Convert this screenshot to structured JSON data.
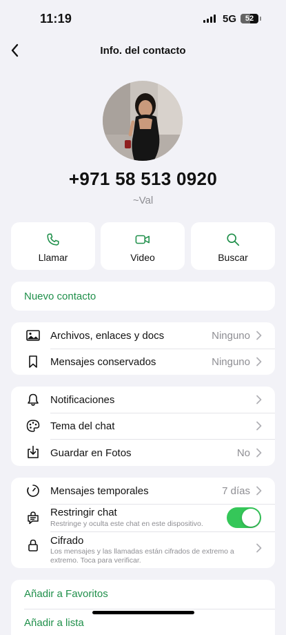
{
  "status_bar": {
    "time": "11:19",
    "network": "5G",
    "battery": "52",
    "battery_level": 0.52
  },
  "nav": {
    "title": "Info. del contacto",
    "back_icon": "chevron-left-icon"
  },
  "contact": {
    "phone": "+971 58 513 0920",
    "alias": "~Val"
  },
  "actions": [
    {
      "label": "Llamar",
      "icon": "phone-icon"
    },
    {
      "label": "Video",
      "icon": "video-icon"
    },
    {
      "label": "Buscar",
      "icon": "search-icon"
    }
  ],
  "new_contact": {
    "label": "Nuevo contacto"
  },
  "media_group": [
    {
      "label": "Archivos, enlaces y docs",
      "value": "Ninguno",
      "icon": "image-icon"
    },
    {
      "label": "Mensajes conservados",
      "value": "Ninguno",
      "icon": "bookmark-icon"
    }
  ],
  "settings_group": [
    {
      "label": "Notificaciones",
      "value": "",
      "icon": "bell-icon"
    },
    {
      "label": "Tema del chat",
      "value": "",
      "icon": "palette-icon"
    },
    {
      "label": "Guardar en Fotos",
      "value": "No",
      "icon": "download-icon"
    }
  ],
  "privacy_group": {
    "disappearing": {
      "label": "Mensajes temporales",
      "value": "7 días",
      "icon": "timer-icon"
    },
    "lock": {
      "label": "Restringir chat",
      "sub": "Restringe y oculta este chat en este dispositivo.",
      "icon": "lock-chat-icon",
      "enabled": true
    },
    "encryption": {
      "label": "Cifrado",
      "sub": "Los mensajes y las llamadas están cifrados de extremo a extremo. Toca para verificar.",
      "icon": "padlock-icon"
    }
  },
  "favorites": {
    "add_favorites": "Añadir a Favoritos",
    "add_list": "Añadir a lista"
  },
  "colors": {
    "accent_green": "#1f8f4a",
    "toggle_green": "#35c759",
    "background": "#f2f2f7"
  }
}
